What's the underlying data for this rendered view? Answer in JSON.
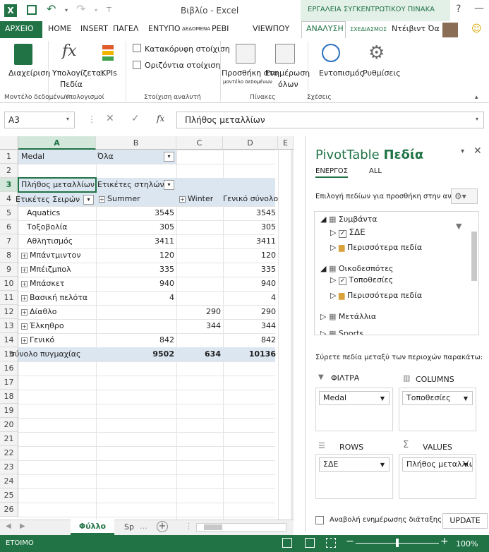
{
  "window": {
    "title": "Βιβλίο - Excel",
    "context_title": "ΕΡΓΑΛΕΙΑ ΣΥΓΚΕΝΤΡΩΤΙΚΟΥ ΠΙΝΑΚΑ",
    "help": "?",
    "colors": {
      "excel_green": "#217346",
      "pivot_header": "#dce6f1",
      "accent": "#207245"
    }
  },
  "tabs": {
    "file": "ΑΡΧΕΙΟ",
    "home": "HOME",
    "insert": "INSERT",
    "page": "ΠΑΓΕΛ",
    "print": "ΕΝΤΥΠΟ",
    "data": "ΔΕΔΟΜΕΝΑ",
    "review": "ΡΕΒΙ",
    "view": "VIEWΠΟΥ",
    "analyze": "ΑΝΑΛΥΣΗ",
    "design": "ΣΧΕΔΙΑΣΜΟΣ",
    "user": "Ντέιβιντ Όα"
  },
  "ribbon": {
    "manage": "Διαχείριση",
    "calc_fields_1": "Υπολογίζεται",
    "calc_fields_2": "Πεδία",
    "kpis": "KPIs",
    "vertical": "Κατακόρυφη στοίχιση",
    "horizontal": "Οριζόντια στοίχιση",
    "add_1": "Προσθήκη στο",
    "add_2": "μοντέλο δεδομένων",
    "refresh_1": "Ενημέρωση",
    "refresh_2": "όλων",
    "detect": "Εντοπισμός",
    "settings": "Ρυθμίσεις",
    "grp_model": "Μοντέλο δεδομένων",
    "grp_calc": "Υπολογισμοί",
    "grp_align": "Στοίχιση αναλυτή",
    "grp_tables": "Πίνακες",
    "grp_rel": "Σχέσεις"
  },
  "formula": {
    "namebox": "A3",
    "fx": "fx",
    "value": "Πλήθος μεταλλίων"
  },
  "sheet": {
    "columns": [
      "A",
      "B",
      "C",
      "D",
      "E"
    ],
    "rows": [
      "1",
      "2",
      "3",
      "4",
      "5",
      "6",
      "7",
      "8",
      "9",
      "10",
      "11",
      "12",
      "13",
      "14",
      "15",
      "16",
      "17",
      "18",
      "19",
      "20",
      "21",
      "22",
      "23",
      "24",
      "25",
      "26"
    ],
    "filter_label": "Medal",
    "filter_value": "Όλα",
    "values_label": "Πλήθος μεταλλίων",
    "col_labels": "Ετικέτες στηλών",
    "row_labels": "Ετικέτες Σειρών",
    "summer": "Summer",
    "winter": "Winter",
    "grand_total": "Γενικό σύνολο",
    "data_rows": [
      {
        "label": "Aquatics",
        "expand": false,
        "summer": "3545",
        "winter": "",
        "total": "3545"
      },
      {
        "label": "Τοξοβολία",
        "expand": false,
        "summer": "305",
        "winter": "",
        "total": "305"
      },
      {
        "label": "Αθλητισμός",
        "expand": false,
        "summer": "3411",
        "winter": "",
        "total": "3411"
      },
      {
        "label": "Μπάντμιντον",
        "expand": true,
        "summer": "120",
        "winter": "",
        "total": "120"
      },
      {
        "label": "Μπέιζμπολ",
        "expand": true,
        "summer": "335",
        "winter": "",
        "total": "335"
      },
      {
        "label": "Μπάσκετ",
        "expand": true,
        "summer": "940",
        "winter": "",
        "total": "940"
      },
      {
        "label": "Βασική πελότα",
        "expand": true,
        "summer": "4",
        "winter": "",
        "total": "4"
      },
      {
        "label": "Δίαθλο",
        "expand": true,
        "summer": "",
        "winter": "290",
        "total": "290"
      },
      {
        "label": "Έλκηθρο",
        "expand": true,
        "summer": "",
        "winter": "344",
        "total": "344"
      },
      {
        "label": "Γενικό",
        "expand": true,
        "summer": "842",
        "winter": "",
        "total": "842"
      }
    ],
    "total_row": {
      "label": "σύνολο πυγμαχίας",
      "summer": "9502",
      "winter": "634",
      "total": "10136"
    },
    "tab_active": "Φύλλο",
    "tab_next": "Sp"
  },
  "panel": {
    "title": "PivotTable",
    "title_bold": "Πεδία",
    "tab_active": "ΕΝΕΡΓΟΣ",
    "tab_all": "ALL",
    "choose": "Επιλογή πεδίων για προσθήκη στην αναφορά:",
    "tables": [
      {
        "name": "Συμβάντα",
        "fields": [
          {
            "name": "ΣΔΕ",
            "checked": true
          }
        ],
        "more": "Περισσότερα πεδία"
      },
      {
        "name": "Οικοδεσπότες",
        "fields": [
          {
            "name": "Τοποθεσίες",
            "checked": true
          }
        ],
        "more": "Περισσότερα πεδία"
      },
      {
        "name": "Μετάλλια"
      },
      {
        "name": "Sports"
      }
    ],
    "drag": "Σύρετε πεδία μεταξύ των περιοχών παρακάτω:",
    "filters": "ΦΙΛΤΡΑ",
    "columns": "COLUMNS",
    "rows": "ROWS",
    "values": "VALUES",
    "filters_chip": "Medal",
    "columns_chip": "Τοποθεσίες",
    "rows_chip": "ΣΔΕ",
    "values_chip": "Πλήθος μεταλλίων",
    "defer": "Αναβολή ενημέρωσης διάταξης",
    "update": "UPDATE"
  },
  "status": {
    "ready": "ΕΤΟΙΜΟ",
    "zoom": "100%",
    "zoom_level": 1.0
  }
}
